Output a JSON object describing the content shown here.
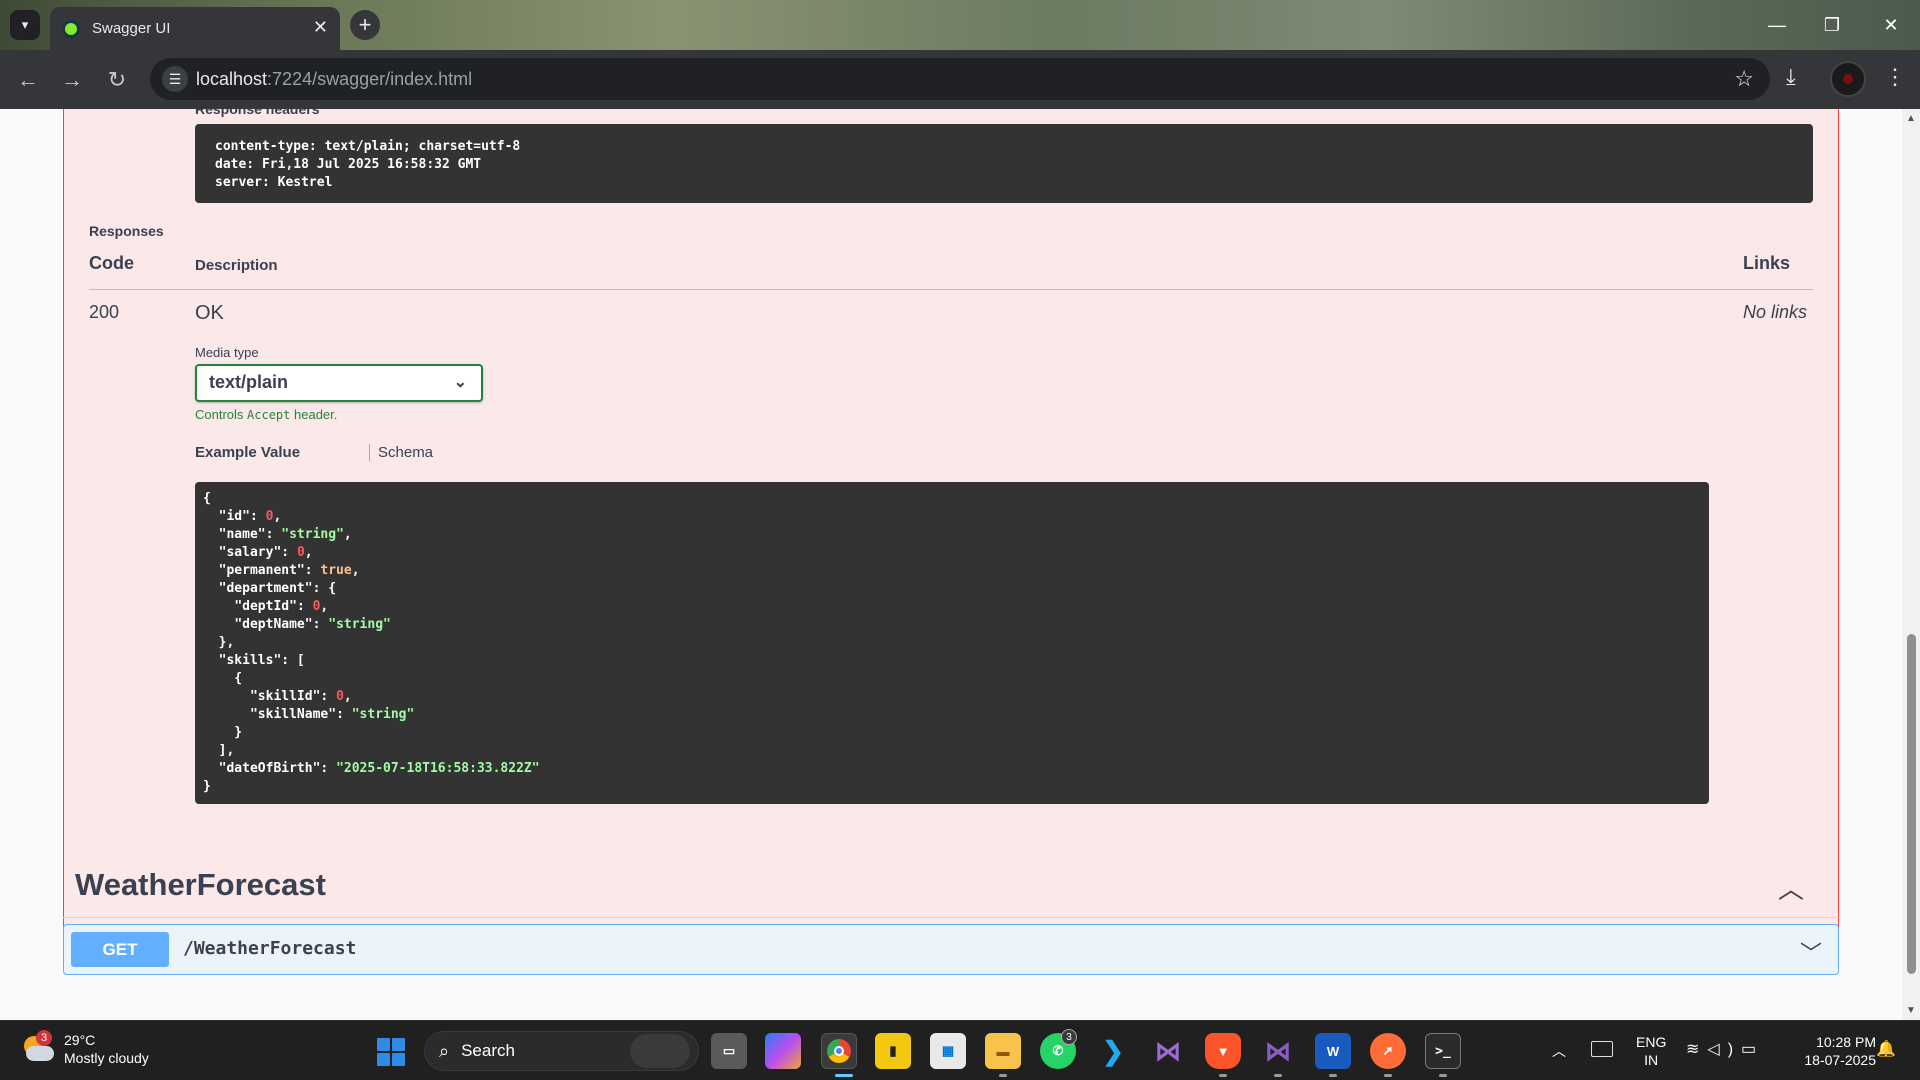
{
  "browser": {
    "tab_title": "Swagger UI",
    "url_host": "localhost",
    "url_rest": ":7224/swagger/index.html"
  },
  "response": {
    "headers_label": "Response headers",
    "headers_lines": [
      "content-type: text/plain; charset=utf-8",
      "date: Fri,18 Jul 2025 16:58:32 GMT",
      "server: Kestrel"
    ]
  },
  "responses": {
    "section_label": "Responses",
    "col_code": "Code",
    "col_description": "Description",
    "col_links": "Links",
    "row": {
      "code": "200",
      "description": "OK",
      "links": "No links",
      "media_type_label": "Media type",
      "media_type_value": "text/plain",
      "controls_pre": "Controls ",
      "controls_code": "Accept",
      "controls_post": " header.",
      "example_tab": "Example Value",
      "schema_tab": "Schema"
    }
  },
  "example_json_lines": [
    "{",
    "  \"id\": 0,",
    "  \"name\": \"string\",",
    "  \"salary\": 0,",
    "  \"permanent\": true,",
    "  \"department\": {",
    "    \"deptId\": 0,",
    "    \"deptName\": \"string\"",
    "  },",
    "  \"skills\": [",
    "    {",
    "      \"skillId\": 0,",
    "      \"skillName\": \"string\"",
    "    }",
    "  ],",
    "  \"dateOfBirth\": \"2025-07-18T16:58:33.822Z\"",
    "}"
  ],
  "section": {
    "title": "WeatherForecast",
    "endpoint": {
      "method": "GET",
      "path": "/WeatherForecast"
    }
  },
  "taskbar": {
    "weather_temp": "29°C",
    "weather_desc": "Mostly cloudy",
    "weather_badge": "3",
    "search_label": "Search",
    "whatsapp_badge": "3",
    "lang_top": "ENG",
    "lang_bottom": "IN",
    "time": "10:28 PM",
    "date": "18-07-2025"
  },
  "colors": {
    "delete_border": "#f93e3e",
    "delete_bg": "#fbe8e8",
    "get_accent": "#61affe",
    "media_select_border": "#22863a"
  }
}
